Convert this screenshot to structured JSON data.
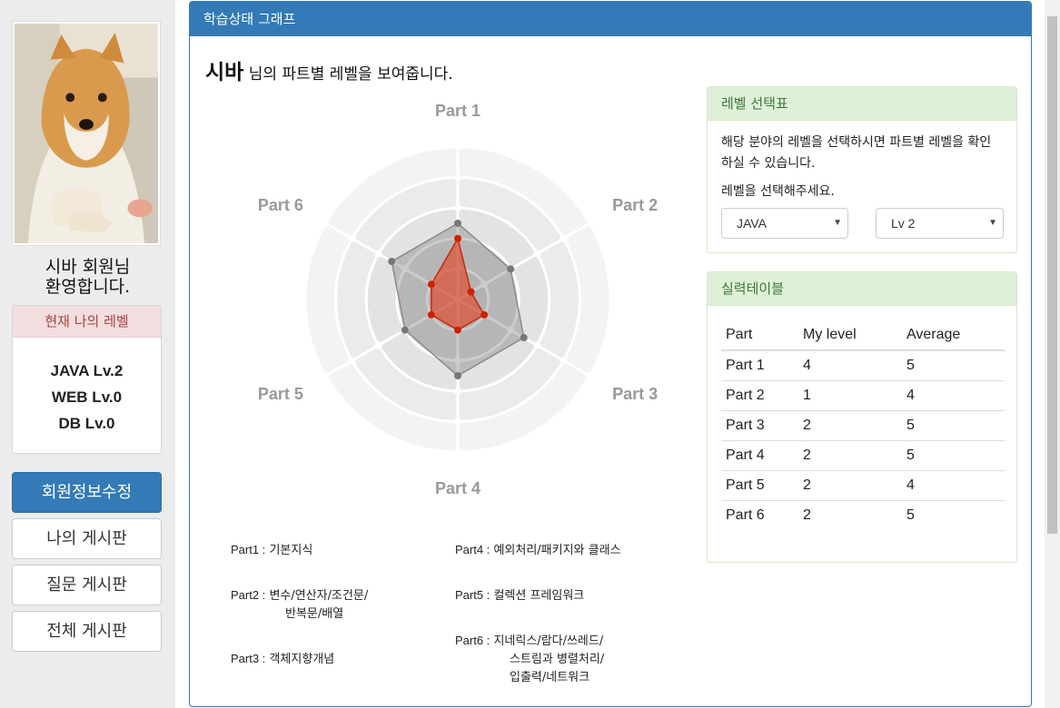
{
  "sidebar": {
    "welcome_line1": "시바 회원님",
    "welcome_line2": "환영합니다.",
    "level_panel_title": "현재 나의 레벨",
    "levels": [
      "JAVA Lv.2",
      "WEB Lv.0",
      "DB Lv.0"
    ],
    "nav": [
      "회원정보수정",
      "나의 게시판",
      "질문 게시판",
      "전체 게시판"
    ]
  },
  "main": {
    "card_title": "학습상태 그래프",
    "user_name": "시바",
    "intro_rest": " 님의 파트별 레벨을 보여줍니다.",
    "legend": [
      {
        "key": "Part1 :",
        "lines": [
          "기본지식"
        ]
      },
      {
        "key": "Part2 :",
        "lines": [
          "변수/연산자/조건문/",
          "반복문/배열"
        ]
      },
      {
        "key": "Part3 :",
        "lines": [
          "객체지향개념"
        ]
      },
      {
        "key": "Part4 :",
        "lines": [
          "예외처리/패키지와 클래스"
        ]
      },
      {
        "key": "Part5 :",
        "lines": [
          "컬렉션 프레임워크"
        ]
      },
      {
        "key": "Part6 :",
        "lines": [
          "지네릭스/람다/쓰레드/",
          "스트림과 병렬처리/",
          "입출력/네트워크"
        ]
      }
    ]
  },
  "chart_data": {
    "type": "radar",
    "categories": [
      "Part 1",
      "Part 2",
      "Part 3",
      "Part 4",
      "Part 5",
      "Part 6"
    ],
    "series": [
      {
        "values": [
          4,
          1,
          2,
          2,
          2,
          2
        ],
        "color": "#cc2200"
      },
      {
        "values": [
          5,
          4,
          5,
          5,
          4,
          5
        ],
        "color": "#888888"
      }
    ],
    "rmax": 10
  },
  "level_select": {
    "title": "레벨 선택표",
    "description": "해당 분야의 레벨을 선택하시면 파트별 레벨을 확인하실 수 있습니다.",
    "prompt": "레벨을 선택해주세요.",
    "subject_value": "JAVA",
    "level_value": "Lv 2"
  },
  "skill_table": {
    "title": "실력테이블",
    "headers": [
      "Part",
      "My level",
      "Average"
    ],
    "rows": [
      [
        "Part 1",
        "4",
        "5"
      ],
      [
        "Part 2",
        "1",
        "4"
      ],
      [
        "Part 3",
        "2",
        "5"
      ],
      [
        "Part 4",
        "2",
        "5"
      ],
      [
        "Part 5",
        "2",
        "4"
      ],
      [
        "Part 6",
        "2",
        "5"
      ]
    ]
  },
  "colors": {
    "primary": "#337ab7",
    "success_bg": "#dff0d8",
    "danger_bg": "#f2dede"
  }
}
